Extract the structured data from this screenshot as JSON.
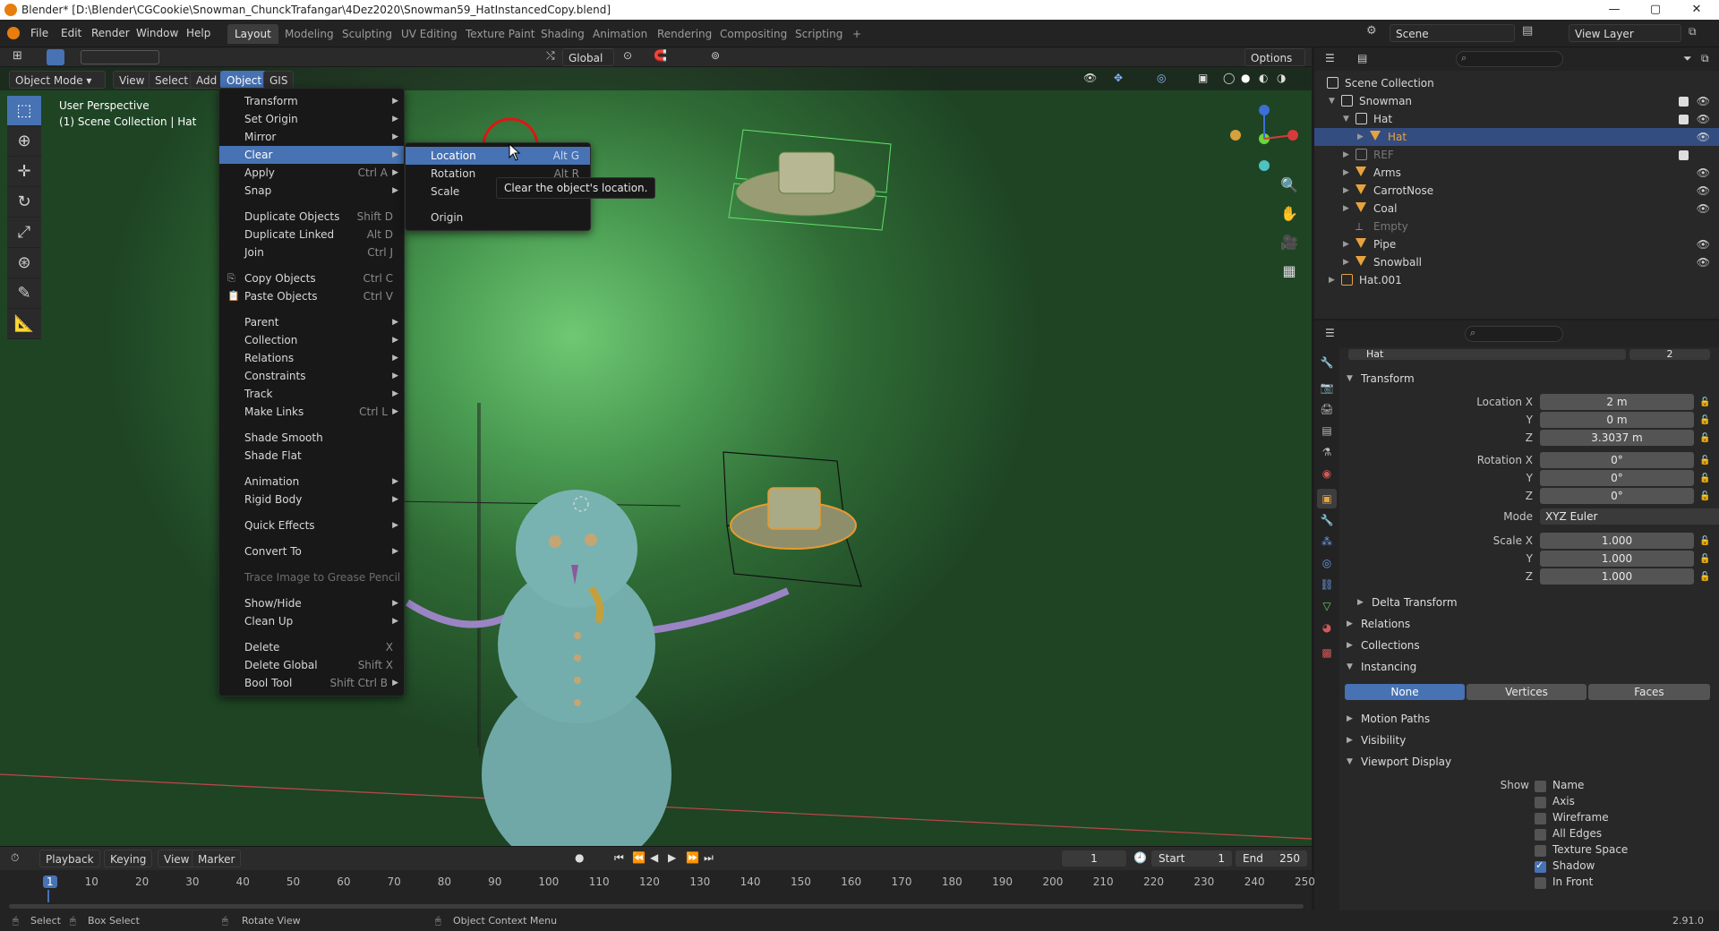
{
  "window": {
    "title": "Blender* [D:\\Blender\\CGCookie\\Snowman_ChunckTrafangar\\4Dez2020\\Snowman59_HatInstancedCopy.blend]",
    "minimize": "—",
    "maximize": "▢",
    "close": "✕"
  },
  "topmenu": [
    "File",
    "Edit",
    "Render",
    "Window",
    "Help"
  ],
  "workspaces": [
    "Layout",
    "Modeling",
    "Sculpting",
    "UV Editing",
    "Texture Paint",
    "Shading",
    "Animation",
    "Rendering",
    "Compositing",
    "Scripting",
    "+"
  ],
  "scene_name": "Scene",
  "view_layer": "View Layer",
  "transform_orientation": "Global",
  "options_label": "Options",
  "viewport": {
    "mode": "Object Mode",
    "menus": [
      "View",
      "Select",
      "Add",
      "Object",
      "GIS"
    ],
    "info_line1": "User Perspective",
    "info_line2": "(1) Scene Collection | Hat"
  },
  "object_menu": {
    "items": [
      {
        "label": "Transform",
        "shortcut": "",
        "sub": true
      },
      {
        "label": "Set Origin",
        "shortcut": "",
        "sub": true
      },
      {
        "label": "Mirror",
        "shortcut": "",
        "sub": true
      },
      {
        "label": "Clear",
        "shortcut": "",
        "sub": true
      },
      {
        "label": "Apply",
        "shortcut": "Ctrl A",
        "sub": true
      },
      {
        "label": "Snap",
        "shortcut": "",
        "sub": true
      },
      {
        "label": "Duplicate Objects",
        "shortcut": "Shift D",
        "sub": false
      },
      {
        "label": "Duplicate Linked",
        "shortcut": "Alt D",
        "sub": false
      },
      {
        "label": "Join",
        "shortcut": "Ctrl J",
        "sub": false
      },
      {
        "label": "Copy Objects",
        "shortcut": "Ctrl C",
        "sub": false
      },
      {
        "label": "Paste Objects",
        "shortcut": "Ctrl V",
        "sub": false
      },
      {
        "label": "Parent",
        "shortcut": "",
        "sub": true
      },
      {
        "label": "Collection",
        "shortcut": "",
        "sub": true
      },
      {
        "label": "Relations",
        "shortcut": "",
        "sub": true
      },
      {
        "label": "Constraints",
        "shortcut": "",
        "sub": true
      },
      {
        "label": "Track",
        "shortcut": "",
        "sub": true
      },
      {
        "label": "Make Links",
        "shortcut": "Ctrl L",
        "sub": true
      },
      {
        "label": "Shade Smooth",
        "shortcut": "",
        "sub": false
      },
      {
        "label": "Shade Flat",
        "shortcut": "",
        "sub": false
      },
      {
        "label": "Animation",
        "shortcut": "",
        "sub": true
      },
      {
        "label": "Rigid Body",
        "shortcut": "",
        "sub": true
      },
      {
        "label": "Quick Effects",
        "shortcut": "",
        "sub": true
      },
      {
        "label": "Convert To",
        "shortcut": "",
        "sub": true
      },
      {
        "label": "Trace Image to Grease Pencil",
        "shortcut": "",
        "sub": false
      },
      {
        "label": "Show/Hide",
        "shortcut": "",
        "sub": true
      },
      {
        "label": "Clean Up",
        "shortcut": "",
        "sub": true
      },
      {
        "label": "Delete",
        "shortcut": "X",
        "sub": false
      },
      {
        "label": "Delete Global",
        "shortcut": "Shift X",
        "sub": false
      },
      {
        "label": "Bool Tool",
        "shortcut": "Shift Ctrl B",
        "sub": true
      }
    ]
  },
  "clear_menu": {
    "items": [
      {
        "label": "Location",
        "shortcut": "Alt G"
      },
      {
        "label": "Rotation",
        "shortcut": "Alt R"
      },
      {
        "label": "Scale",
        "shortcut": ""
      },
      {
        "label": "Origin",
        "shortcut": ""
      }
    ]
  },
  "tooltip": "Clear the object's location.",
  "outliner": {
    "rows": [
      {
        "label": "Scene Collection"
      },
      {
        "label": "Snowman"
      },
      {
        "label": "Hat"
      },
      {
        "label": "Hat"
      },
      {
        "label": "REF"
      },
      {
        "label": "Arms"
      },
      {
        "label": "CarrotNose"
      },
      {
        "label": "Coal"
      },
      {
        "label": "Empty"
      },
      {
        "label": "Pipe"
      },
      {
        "label": "Snowball"
      },
      {
        "label": "Hat.001"
      }
    ]
  },
  "properties": {
    "object_name": "Hat",
    "user_count": "2",
    "transform_title": "Transform",
    "location_x_label": "Location X",
    "location_x": "2 m",
    "y_label": "Y",
    "location_y": "0 m",
    "z_label": "Z",
    "location_z": "3.3037 m",
    "rotation_x_label": "Rotation X",
    "rotation_x": "0°",
    "rotation_y": "0°",
    "rotation_z": "0°",
    "mode_label": "Mode",
    "mode": "XYZ Euler",
    "scale_x_label": "Scale X",
    "scale_x": "1.000",
    "scale_y": "1.000",
    "scale_z": "1.000",
    "delta_transform": "Delta Transform",
    "relations": "Relations",
    "collections": "Collections",
    "instancing": "Instancing",
    "instancing_options": [
      "None",
      "Vertices",
      "Faces"
    ],
    "motion_paths": "Motion Paths",
    "visibility": "Visibility",
    "viewport_display": "Viewport Display",
    "show_label": "Show",
    "show_options": [
      {
        "label": "Name",
        "checked": false
      },
      {
        "label": "Axis",
        "checked": false
      },
      {
        "label": "Wireframe",
        "checked": false
      },
      {
        "label": "All Edges",
        "checked": false
      },
      {
        "label": "Texture Space",
        "checked": false
      },
      {
        "label": "Shadow",
        "checked": true
      },
      {
        "label": "In Front",
        "checked": false
      }
    ]
  },
  "timeline": {
    "menus": [
      "Playback",
      "Keying",
      "View",
      "Marker"
    ],
    "current_frame": "1",
    "start_label": "Start",
    "start": "1",
    "end_label": "End",
    "end": "250",
    "ticks": [
      "1",
      "10",
      "20",
      "30",
      "40",
      "50",
      "60",
      "70",
      "80",
      "90",
      "100",
      "110",
      "120",
      "130",
      "140",
      "150",
      "160",
      "170",
      "180",
      "190",
      "200",
      "210",
      "220",
      "230",
      "240",
      "250"
    ]
  },
  "statusbar": {
    "select": "Select",
    "box_select": "Box Select",
    "rotate_view": "Rotate View",
    "context_menu": "Object Context Menu",
    "version": "2.91.0"
  },
  "colors": {
    "accent": "#4772b3",
    "selected_row": "#334d80",
    "object_orange": "#e8a33d",
    "mesh_green": "#5cd65c"
  }
}
